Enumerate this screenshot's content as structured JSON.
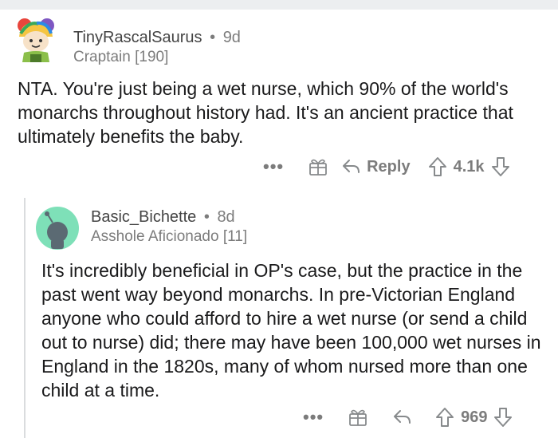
{
  "comment1": {
    "username": "TinyRascalSaurus",
    "age": "9d",
    "flair": "Craptain [190]",
    "body": "NTA. You're just being a wet nurse, which 90% of the world's monarchs throughout history had. It's an ancient practice that ultimately benefits the baby.",
    "reply_label": "Reply",
    "score": "4.1k"
  },
  "comment2": {
    "username": "Basic_Bichette",
    "age": "8d",
    "flair": "Asshole Aficionado [11]",
    "body": "It's incredibly beneficial in OP's case, but the practice in the past went way beyond monarchs. In pre-Victorian England anyone who could afford to hire a wet nurse (or send a child out to nurse) did; there may have been 100,000 wet nurses in England in the 1820s, many of whom nursed more than one child at a time.",
    "score": "969"
  },
  "separator": "•",
  "more_label": "•••",
  "icons": [
    "more-icon",
    "award-icon",
    "reply-icon",
    "upvote-icon",
    "downvote-icon",
    "avatar-icon"
  ]
}
